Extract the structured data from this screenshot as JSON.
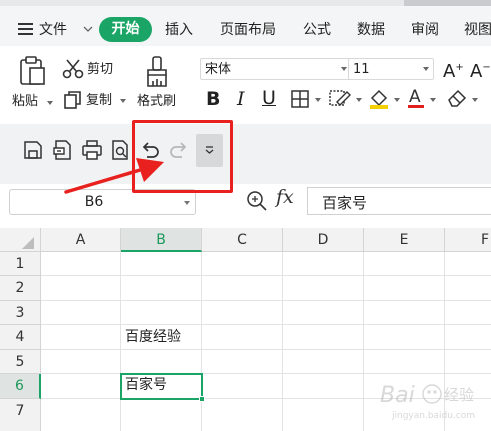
{
  "menu": {
    "file": "文件",
    "tabs": [
      "开始",
      "插入",
      "页面布局",
      "公式",
      "数据",
      "审阅",
      "视图"
    ],
    "active_tab_color": "#1aa566"
  },
  "ribbon": {
    "paste": "粘贴",
    "cut": "剪切",
    "copy": "复制",
    "format_painter": "格式刷",
    "font_name": "宋体",
    "font_size": "11",
    "bold": "B",
    "italic": "I",
    "underline": "U",
    "font_color_bar": "#e0201e",
    "fill_color_bar": "#f5d000"
  },
  "annotation": {
    "arrow_color": "#e8201e",
    "box_color": "#e8201e"
  },
  "formula_bar": {
    "name_box": "B6",
    "fx": "fx",
    "content": "百家号"
  },
  "grid": {
    "columns": [
      "A",
      "B",
      "C",
      "D",
      "E",
      "F"
    ],
    "selected_column": "B",
    "rows": [
      "1",
      "2",
      "3",
      "4",
      "5",
      "6",
      "7"
    ],
    "selected_row": "6",
    "cells": {
      "B4": "百度经验",
      "B6": "百家号"
    }
  },
  "watermark": {
    "text": "Bai",
    "sub": "jingyan.baidu.com"
  }
}
